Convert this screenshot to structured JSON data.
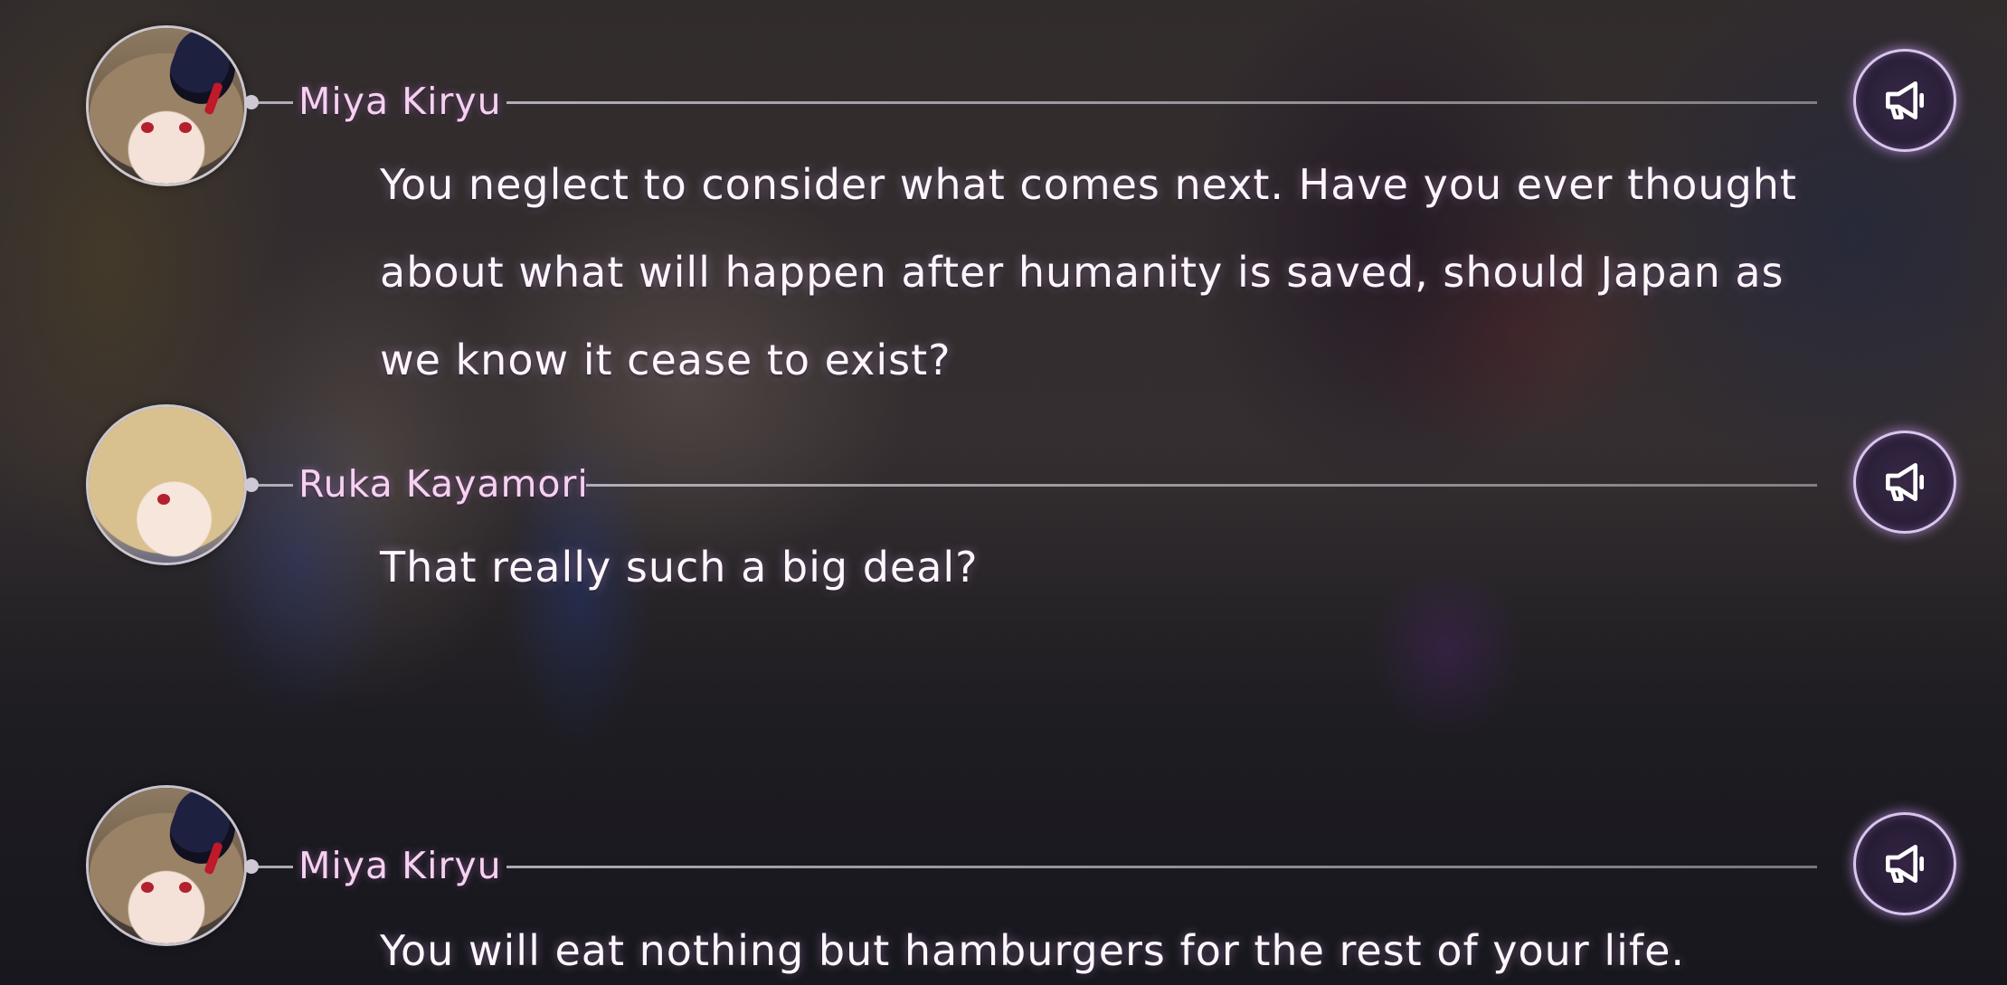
{
  "backlog": {
    "entries": [
      {
        "speaker": "Miya Kiryu",
        "lines": [
          "You neglect to consider what comes next. Have you ever thought",
          "about what will happen after humanity is saved, should Japan as",
          "we know it cease to exist?"
        ],
        "voice_icon": "megaphone-icon"
      },
      {
        "speaker": "Ruka Kayamori",
        "lines": [
          "That really such a big deal?"
        ],
        "voice_icon": "megaphone-icon"
      },
      {
        "speaker": "Miya Kiryu",
        "lines": [
          "You will eat nothing but hamburgers for the rest of your life."
        ],
        "voice_icon": "megaphone-icon"
      }
    ]
  },
  "colors": {
    "speaker_name": "#f6d2f0",
    "dialogue_text": "#fdf6fb",
    "voice_button_glow": "#d8c6ec"
  }
}
